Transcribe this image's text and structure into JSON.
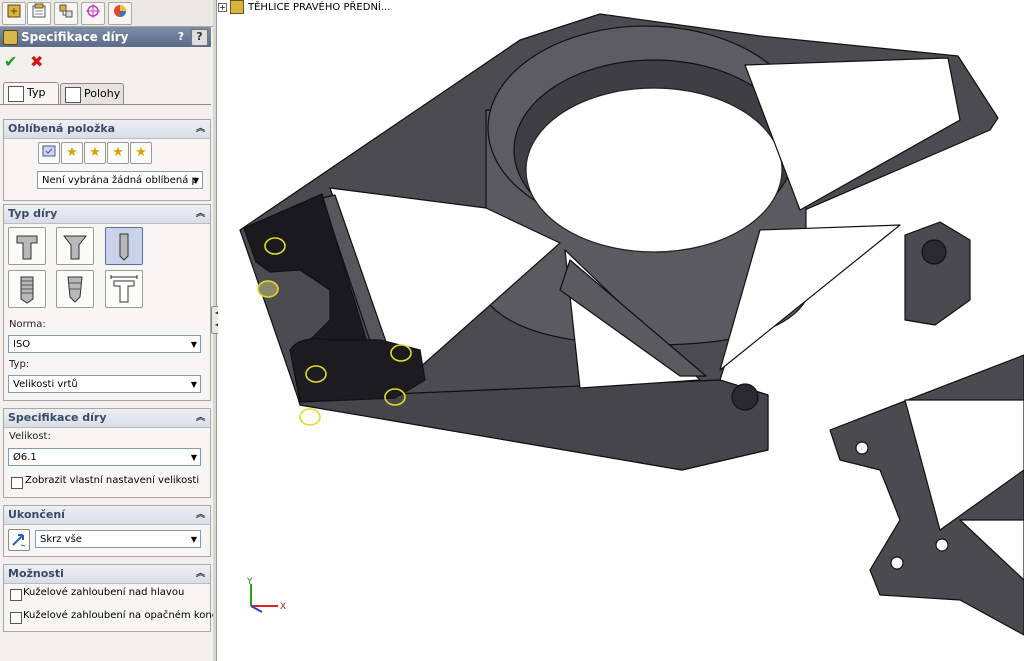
{
  "manager_tabs": [
    {
      "name": "feature-manager",
      "icon": "feature-tree-icon"
    },
    {
      "name": "property-manager",
      "icon": "property-manager-icon"
    },
    {
      "name": "configuration-manager",
      "icon": "configuration-icon"
    },
    {
      "name": "dimxpert-manager",
      "icon": "target-icon"
    },
    {
      "name": "display-manager",
      "icon": "appearance-icon"
    }
  ],
  "property_manager": {
    "title": "Specifikace díry",
    "help_glyph": "?",
    "ok_glyph": "✔",
    "cancel_glyph": "✖",
    "tabs": [
      {
        "label": "Typ",
        "active": true
      },
      {
        "label": "Polohy",
        "active": false
      }
    ]
  },
  "favorites": {
    "heading": "Oblíbená položka",
    "buttons": [
      "apply-favorite-icon",
      "add-favorite-icon",
      "delete-favorite-icon",
      "save-favorite-icon",
      "load-favorite-icon"
    ],
    "selected": "Není vybrána žádná oblíbená p"
  },
  "hole_type": {
    "heading": "Typ díry",
    "buttons": [
      "counterbore-icon",
      "countersink-icon",
      "simple-hole-icon",
      "tapped-hole-icon",
      "pipe-tap-icon",
      "legacy-hole-icon"
    ],
    "selected_index": 2,
    "standard_label": "Norma:",
    "standard_value": "ISO",
    "type_label": "Typ:",
    "type_value": "Velikosti vrtů"
  },
  "hole_spec": {
    "heading": "Specifikace díry",
    "size_label": "Velikost:",
    "size_value": "Ø6.1",
    "custom_size_label": "Zobrazit vlastní nastavení velikosti",
    "custom_size_checked": false
  },
  "end_condition": {
    "heading": "Ukončení",
    "value": "Skrz vše"
  },
  "options": {
    "heading": "Možnosti",
    "items": [
      {
        "label": "Kuželové zahloubení nad hlavou",
        "checked": false
      },
      {
        "label": "Kuželové zahloubení na opačném konci",
        "checked": false
      }
    ]
  },
  "viewport": {
    "tree_label": "TĚHLICE PRAVÉHO PŘEDNÍ...",
    "expand_glyph": "+",
    "triad": {
      "x": "X",
      "y": "Y"
    },
    "part_color": "#4a4a4e",
    "highlight_color": "#e3d92a"
  }
}
